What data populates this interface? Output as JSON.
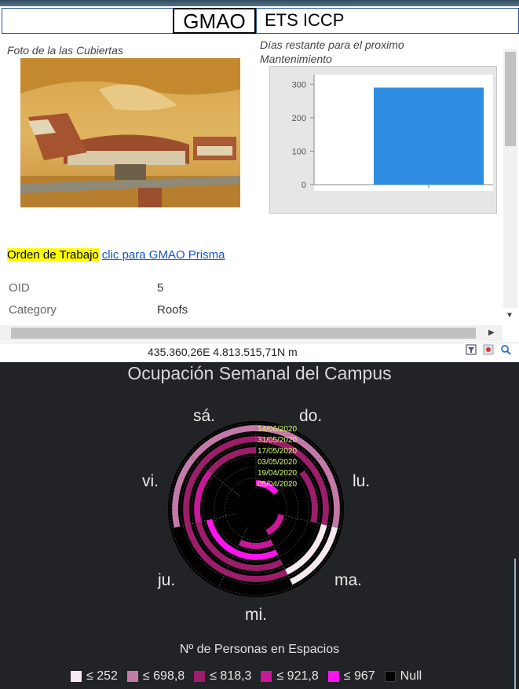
{
  "header": {
    "gmao": "GMAO",
    "ets": "ETS ICCP"
  },
  "popup": {
    "photo_caption": "Foto de la las Cubiertas",
    "chart_caption": "Días restante para el proximo Mantenimiento",
    "orden_label": "Orden de Trabajo",
    "orden_link": "clic para GMAO Prisma",
    "attributes": [
      {
        "key": "OID",
        "value": "5"
      },
      {
        "key": "Category",
        "value": "Roofs"
      }
    ]
  },
  "chart_data": [
    {
      "type": "bar",
      "title": "Días restante para el proximo Mantenimiento",
      "categories": [
        ""
      ],
      "values": [
        290
      ],
      "yticks": [
        0,
        100,
        200,
        300
      ],
      "ylim": [
        0,
        310
      ],
      "bar_color": "#2e8de0"
    },
    {
      "type": "heatmap",
      "title": "Ocupación Semanal del Campus",
      "layout": "radial",
      "days": [
        "do.",
        "lu.",
        "ma.",
        "mi.",
        "ju.",
        "vi.",
        "sá."
      ],
      "weeks": [
        "14/06/2020",
        "31/05/2020",
        "17/05/2020",
        "03/05/2020",
        "19/04/2020",
        "05/04/2020"
      ],
      "legend_title": "Nº de Personas en Espacios",
      "classes": [
        {
          "label": "≤ 252",
          "color": "#f6e9f0"
        },
        {
          "label": "≤ 698,8",
          "color": "#c47aa8"
        },
        {
          "label": "≤ 818,3",
          "color": "#9c1e6a"
        },
        {
          "label": "≤ 921,8",
          "color": "#c91898"
        },
        {
          "label": "≤ 967",
          "color": "#ff14ee"
        },
        {
          "label": "Null",
          "color": "#000000"
        }
      ],
      "cells": [
        [
          1,
          1,
          0,
          5,
          5,
          1,
          1
        ],
        [
          2,
          2,
          0,
          2,
          2,
          2,
          2
        ],
        [
          5,
          2,
          5,
          2,
          2,
          3,
          2
        ],
        [
          5,
          5,
          5,
          4,
          4,
          5,
          5
        ],
        [
          5,
          5,
          5,
          3,
          5,
          5,
          5
        ],
        [
          4,
          5,
          3,
          5,
          5,
          5,
          5
        ]
      ]
    }
  ],
  "statusbar": {
    "coords": "435.360,26E 4.813.515,71N m"
  },
  "colors": {
    "accent": "#2f5597",
    "highlight": "#ffff00",
    "link": "#1155cc",
    "dashboard_bg": "#222326"
  },
  "icons": {
    "tool1": "filter-icon",
    "tool2": "locate-icon",
    "tool3": "search-icon"
  }
}
